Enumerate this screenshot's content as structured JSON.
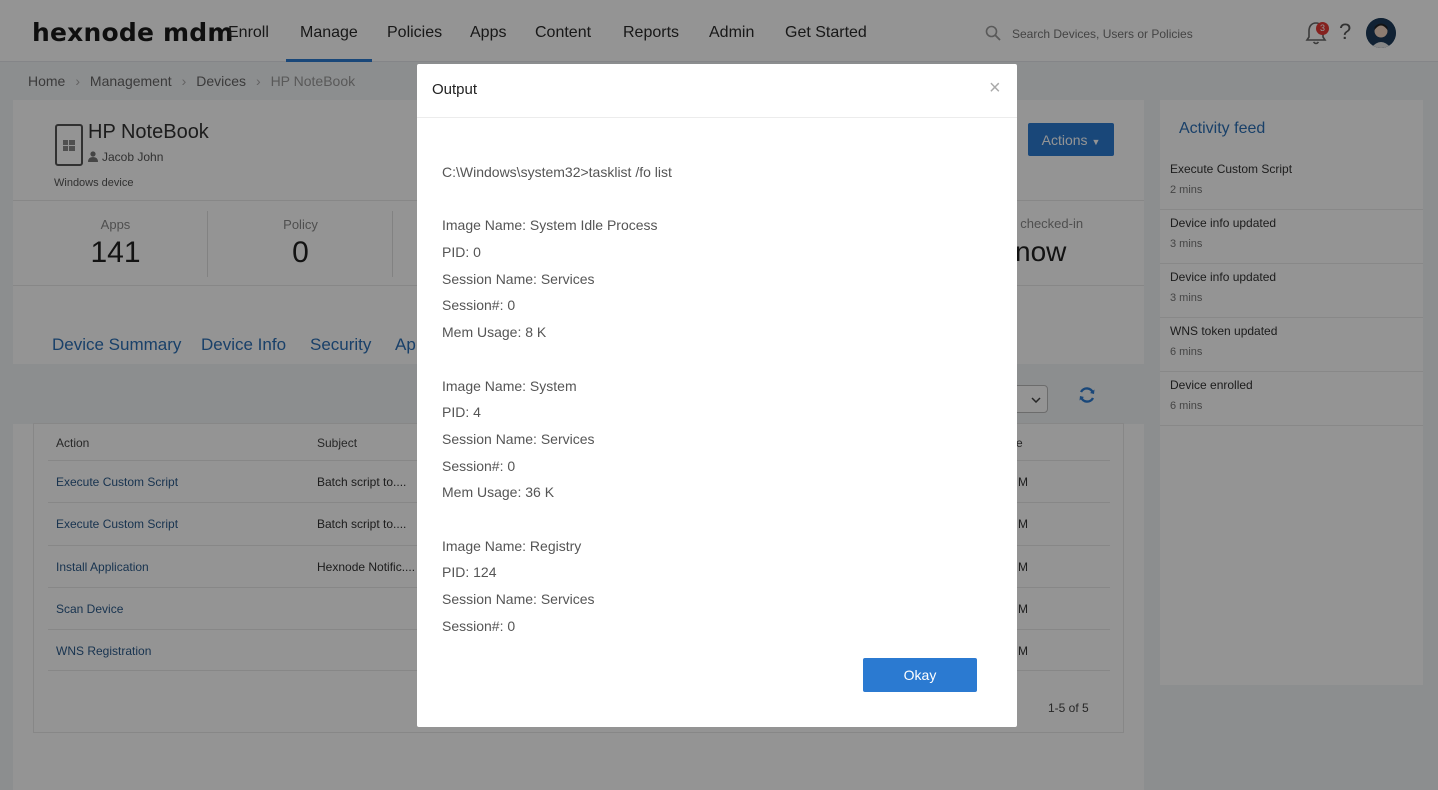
{
  "brand": {
    "logo": "hexnode mdm"
  },
  "nav": {
    "items": [
      "Enroll",
      "Manage",
      "Policies",
      "Apps",
      "Content",
      "Reports",
      "Admin",
      "Get Started"
    ],
    "active": "Manage"
  },
  "search": {
    "placeholder": "Search Devices, Users or Policies"
  },
  "notifications": {
    "count": "3"
  },
  "help": "?",
  "breadcrumb": [
    "Home",
    "Management",
    "Devices",
    "HP NoteBook"
  ],
  "device": {
    "name": "HP NoteBook",
    "user": "Jacob John",
    "type": "Windows device",
    "actions_label": "Actions"
  },
  "stats": [
    {
      "label": "Apps",
      "value": "141"
    },
    {
      "label": "Policy",
      "value": "0"
    }
  ],
  "last_checked": {
    "label": "t checked-in",
    "value": "now"
  },
  "tabs": [
    "Device Summary",
    "Device Info",
    "Security",
    "Ap"
  ],
  "table": {
    "headers": {
      "action": "Action",
      "subject": "Subject",
      "time": "e"
    },
    "rows": [
      {
        "action": "Execute Custom Script",
        "subject": "Batch script to....",
        "time": "M"
      },
      {
        "action": "Execute Custom Script",
        "subject": "Batch script to....",
        "time": "M"
      },
      {
        "action": "Install Application",
        "subject": "Hexnode Notific....",
        "time": "M"
      },
      {
        "action": "Scan Device",
        "subject": "",
        "time": "M"
      },
      {
        "action": "WNS Registration",
        "subject": "",
        "time": "M"
      }
    ],
    "pagination": "1-5 of 5"
  },
  "activity_feed": {
    "title": "Activity feed",
    "items": [
      {
        "title": "Execute Custom Script",
        "time": "2 mins"
      },
      {
        "title": "Device info updated",
        "time": "3 mins"
      },
      {
        "title": "Device info updated",
        "time": "3 mins"
      },
      {
        "title": "WNS token updated",
        "time": "6 mins"
      },
      {
        "title": "Device enrolled",
        "time": "6 mins"
      }
    ]
  },
  "modal": {
    "title": "Output",
    "close": "×",
    "lines": [
      "C:\\Windows\\system32>tasklist /fo list",
      "",
      "Image Name: System Idle Process",
      "PID: 0",
      "Session Name: Services",
      "Session#: 0",
      "Mem Usage: 8 K",
      "",
      "Image Name: System",
      "PID: 4",
      "Session Name: Services",
      "Session#: 0",
      "Mem Usage: 36 K",
      "",
      "Image Name: Registry",
      "PID: 124",
      "Session Name: Services",
      "Session#: 0"
    ],
    "okay_label": "Okay"
  }
}
